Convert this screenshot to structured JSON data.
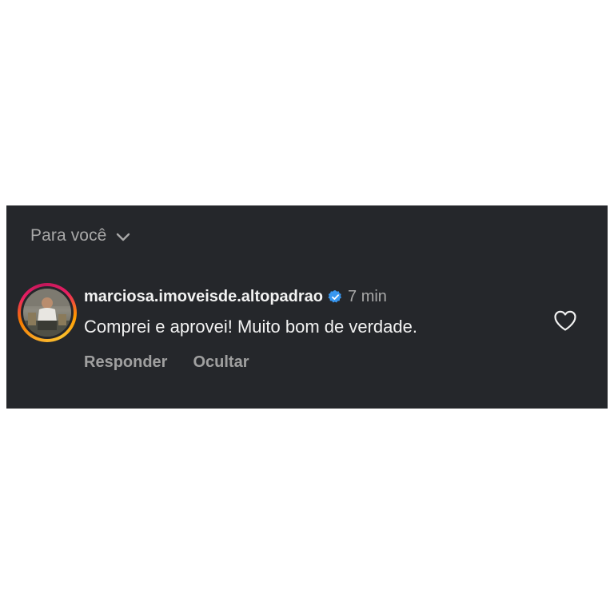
{
  "filter": {
    "label": "Para você",
    "icon": "chevron-down-icon"
  },
  "comment": {
    "username": "marciosa.imoveisde.altopadrao",
    "verified": true,
    "verified_color": "#3897f0",
    "time": "7 min",
    "text": "Comprei e aprovei! Muito bom de verdade.",
    "actions": {
      "reply": "Responder",
      "hide": "Ocultar"
    },
    "like_icon": "heart-outline-icon"
  },
  "colors": {
    "background": "#25272b",
    "text_primary": "#f2f2f2",
    "text_secondary": "#a8a8a8"
  }
}
